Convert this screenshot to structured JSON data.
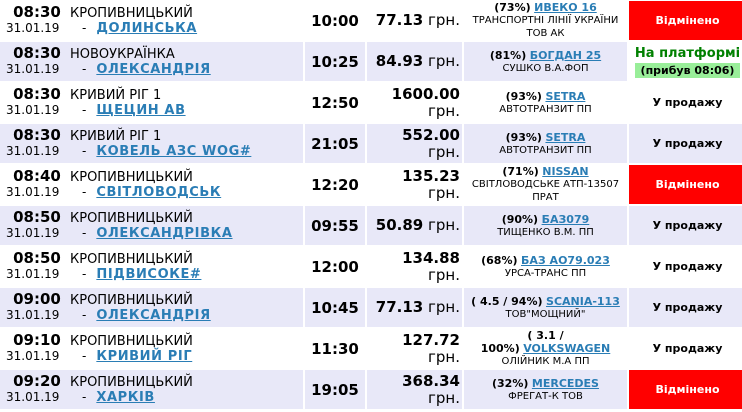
{
  "rows": [
    {
      "dep_time": "08:30",
      "date": "31.01.19",
      "from": "КРОПИВНИЦЬКИЙ",
      "dest": "ДОЛИНСЬКА",
      "arr_time": "10:00",
      "price": "77.13",
      "currency": "грн.",
      "load": "(73%)",
      "model": "ИВЕКО 16",
      "carrier": "ТРАНСПОРТНІ ЛІНІЇ УКРАЇНИ ТОВ АК",
      "status": "Відмінено",
      "status_type": "cancel"
    },
    {
      "dep_time": "08:30",
      "date": "31.01.19",
      "from": "НОВОУКРАЇНКА",
      "dest": "ОЛЕКСАНДРІЯ",
      "arr_time": "10:25",
      "price": "84.93",
      "currency": "грн.",
      "load": "(81%)",
      "model": "БОГДАН 25",
      "carrier": "СУШКО В.А.ФОП",
      "status": "На платформі",
      "status_note": "(прибув 08:06)",
      "status_type": "platform"
    },
    {
      "dep_time": "08:30",
      "date": "31.01.19",
      "from": "КРИВИЙ РІГ 1",
      "dest": "ЩЕЦИН АВ",
      "arr_time": "12:50",
      "price": "1600.00",
      "currency": "грн.",
      "load": "(93%)",
      "model": "SETRA",
      "carrier": "АВТОТРАНЗИТ ПП",
      "status": "У продажу",
      "status_type": "sale"
    },
    {
      "dep_time": "08:30",
      "date": "31.01.19",
      "from": "КРИВИЙ РІГ 1",
      "dest": "КОВЕЛЬ АЗС WOG#",
      "arr_time": "21:05",
      "price": "552.00",
      "currency": "грн.",
      "load": "(93%)",
      "model": "SETRA",
      "carrier": "АВТОТРАНЗИТ ПП",
      "status": "У продажу",
      "status_type": "sale"
    },
    {
      "dep_time": "08:40",
      "date": "31.01.19",
      "from": "КРОПИВНИЦЬКИЙ",
      "dest": "СВІТЛОВОДСЬК",
      "arr_time": "12:20",
      "price": "135.23",
      "currency": "грн.",
      "load": "(71%)",
      "model": "NISSAN",
      "carrier": "СВІТЛОВОДСЬКЕ АТП-13507 ПРАТ",
      "status": "Відмінено",
      "status_type": "cancel"
    },
    {
      "dep_time": "08:50",
      "date": "31.01.19",
      "from": "КРОПИВНИЦЬКИЙ",
      "dest": "ОЛЕКСАНДРІВКА",
      "arr_time": "09:55",
      "price": "50.89",
      "currency": "грн.",
      "load": "(90%)",
      "model": "БАЗ079",
      "carrier": "ТИЩЕНКО В.М. ПП",
      "status": "У продажу",
      "status_type": "sale"
    },
    {
      "dep_time": "08:50",
      "date": "31.01.19",
      "from": "КРОПИВНИЦЬКИЙ",
      "dest": "ПІДВИСОКЕ#",
      "arr_time": "12:00",
      "price": "134.88",
      "currency": "грн.",
      "load": "(68%)",
      "model": "БАЗ АО79.023",
      "carrier": "УРСА-ТРАНС ПП",
      "status": "У продажу",
      "status_type": "sale"
    },
    {
      "dep_time": "09:00",
      "date": "31.01.19",
      "from": "КРОПИВНИЦЬКИЙ",
      "dest": "ОЛЕКСАНДРІЯ",
      "arr_time": "10:45",
      "price": "77.13",
      "currency": "грн.",
      "load": "( 4.5 / 94%)",
      "model": "SCANIA-113",
      "carrier": "ТОВ\"МОЩНИЙ\"",
      "status": "У продажу",
      "status_type": "sale"
    },
    {
      "dep_time": "09:10",
      "date": "31.01.19",
      "from": "КРОПИВНИЦЬКИЙ",
      "dest": "КРИВИЙ РІГ",
      "arr_time": "11:30",
      "price": "127.72",
      "currency": "грн.",
      "load_a": "( 3.1 /",
      "load_b": "100%)",
      "model": "VOLKSWAGEN",
      "carrier": "ОЛІЙНИК М.А ПП",
      "status": "У продажу",
      "status_type": "sale"
    },
    {
      "dep_time": "09:20",
      "date": "31.01.19",
      "from": "КРОПИВНИЦЬКИЙ",
      "dest": "ХАРКІВ",
      "arr_time": "19:05",
      "price": "368.34",
      "currency": "грн.",
      "load": "(32%)",
      "model": "MERCEDES",
      "carrier": "ФРЕГАТ-К ТОВ",
      "status": "Відмінено",
      "status_type": "cancel"
    }
  ]
}
